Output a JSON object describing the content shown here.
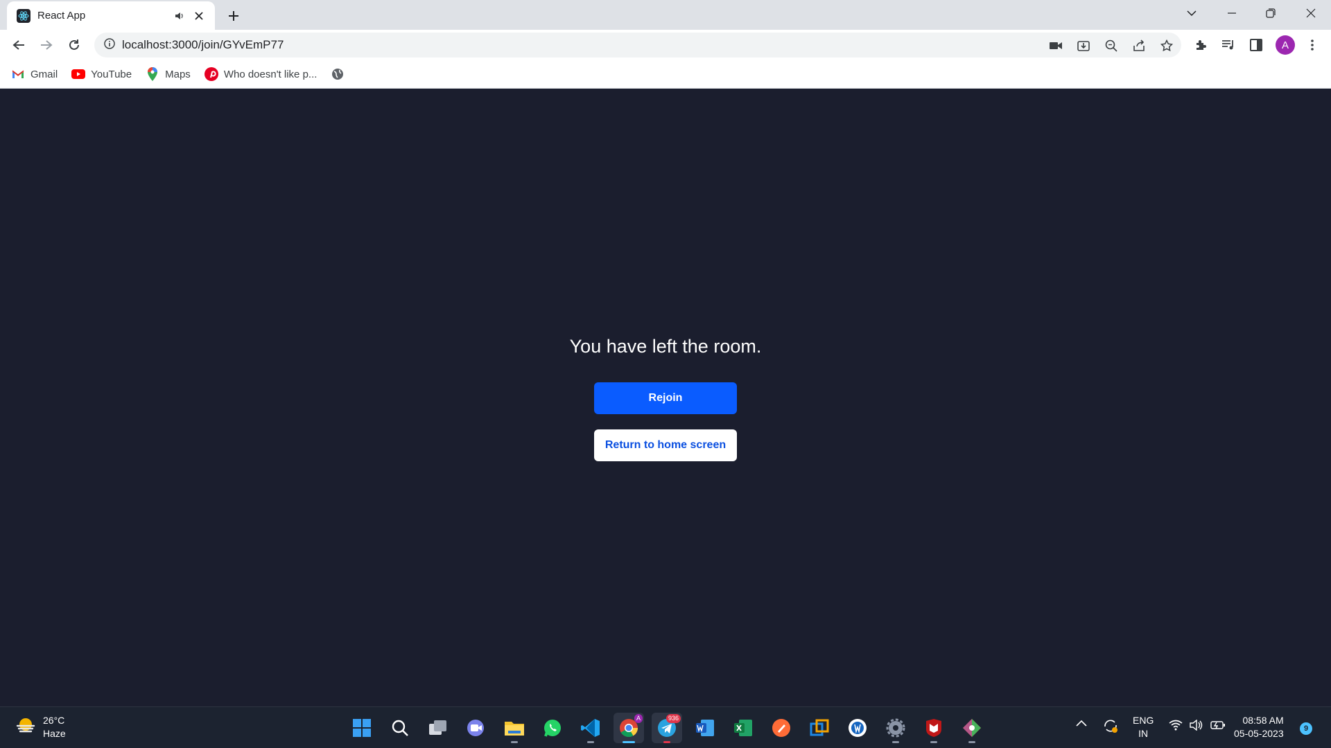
{
  "browser": {
    "tab_title": "React App",
    "url": "localhost:3000/join/GYvEmP77",
    "avatar_letter": "A"
  },
  "bookmarks": [
    {
      "label": "Gmail",
      "icon": "gmail-icon"
    },
    {
      "label": "YouTube",
      "icon": "youtube-icon"
    },
    {
      "label": "Maps",
      "icon": "maps-icon"
    },
    {
      "label": "Who doesn't like p...",
      "icon": "pinterest-icon"
    }
  ],
  "page": {
    "message": "You have left the room.",
    "rejoin_label": "Rejoin",
    "home_label": "Return to home screen"
  },
  "taskbar": {
    "weather_temp": "26°C",
    "weather_desc": "Haze",
    "telegram_badge": "936",
    "lang_top": "ENG",
    "lang_bottom": "IN",
    "time": "08:58 AM",
    "date": "05-05-2023",
    "notification_count": "9"
  },
  "colors": {
    "page_bg": "#1b1e2e",
    "primary_button": "#0a5cff",
    "secondary_button_text": "#0a4fe0"
  }
}
